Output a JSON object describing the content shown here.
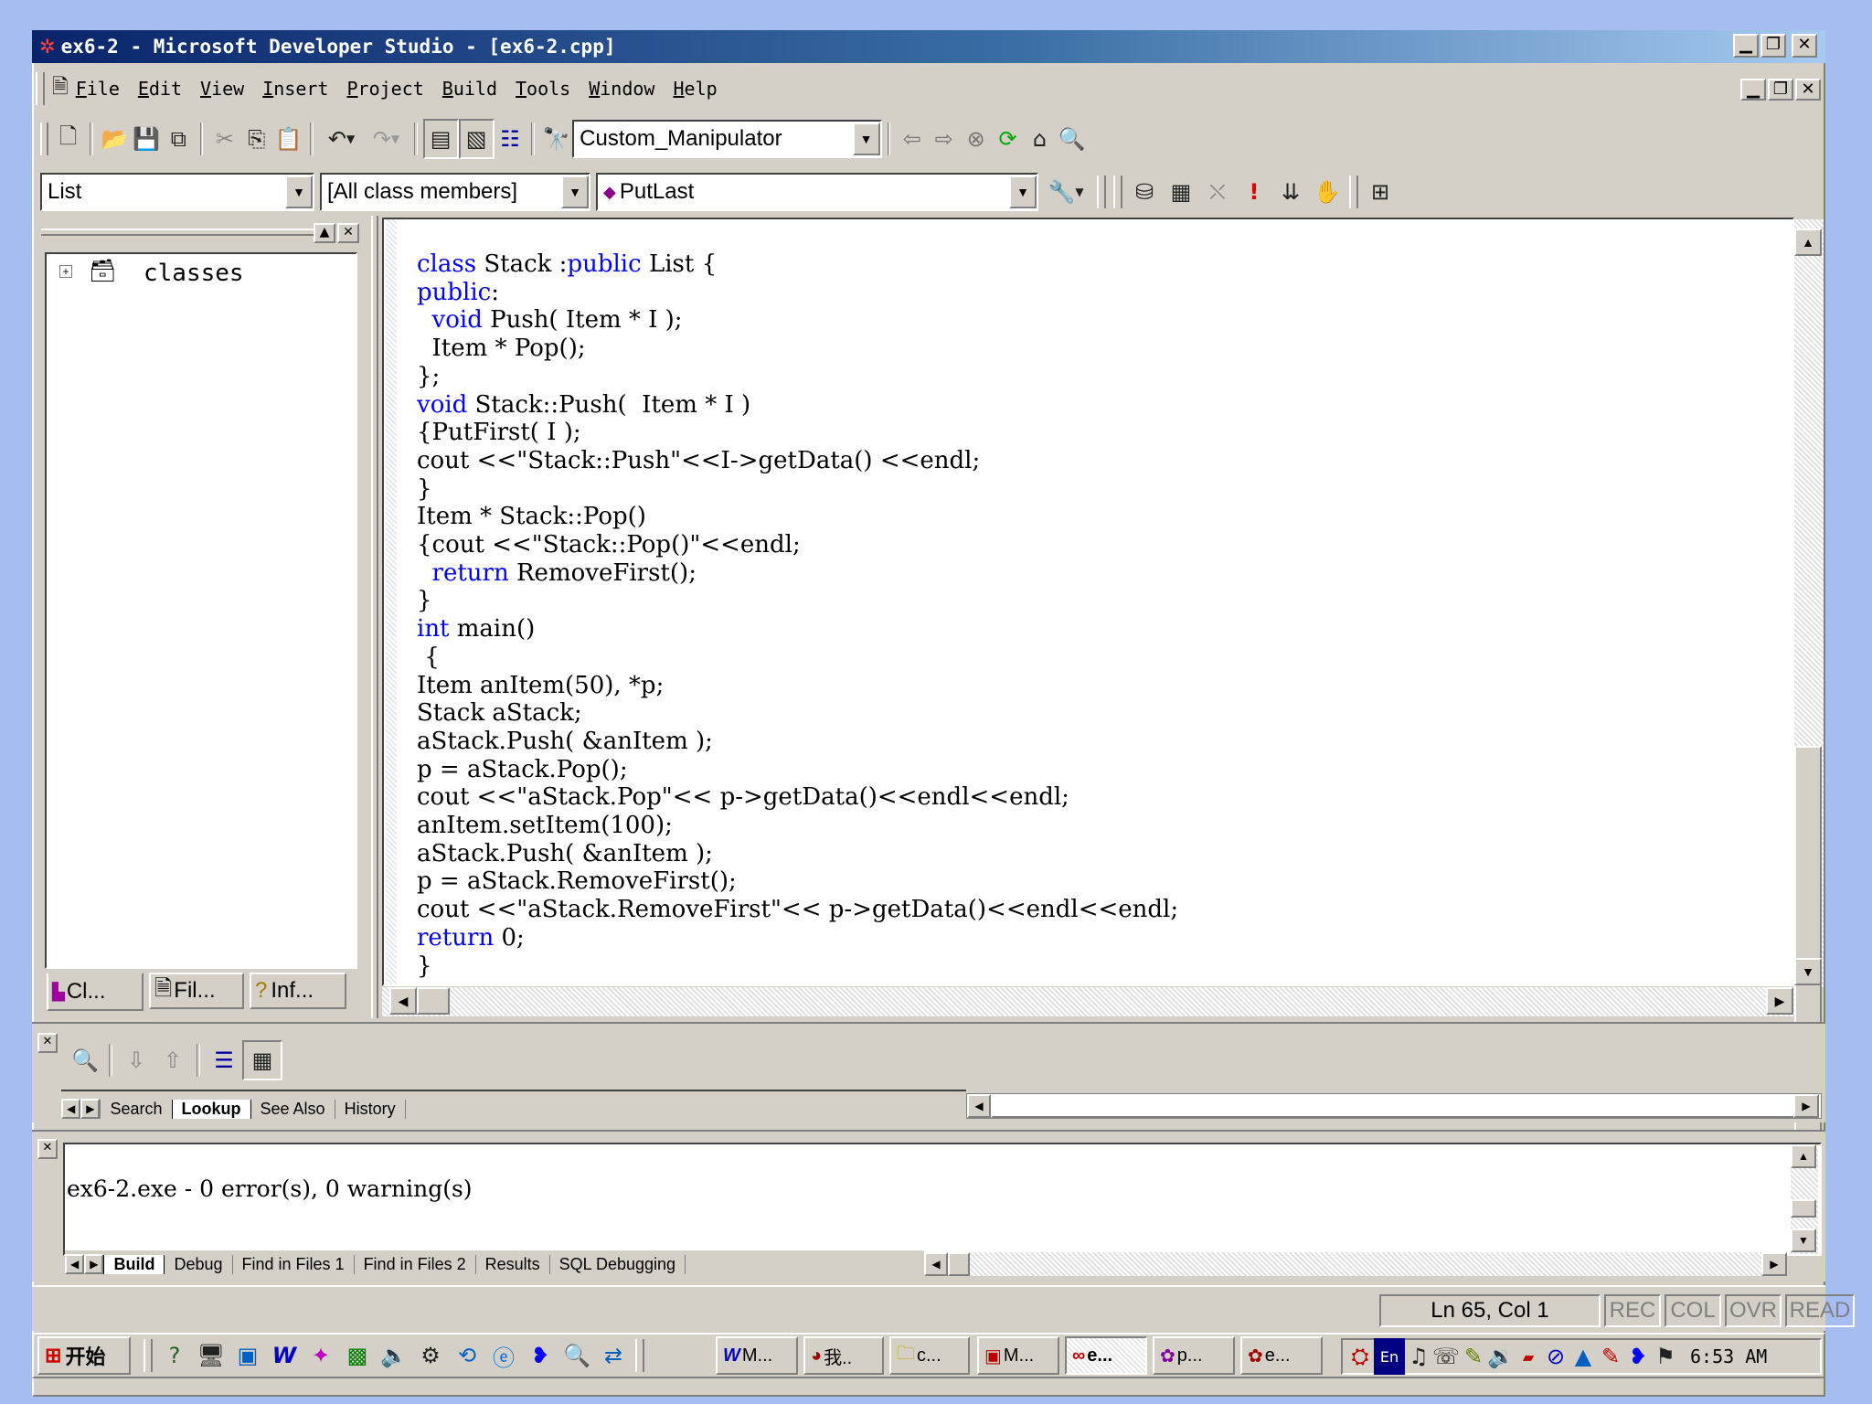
{
  "window": {
    "title": "ex6-2 - Microsoft Developer Studio - [ex6-2.cpp]"
  },
  "menu": [
    "File",
    "Edit",
    "View",
    "Insert",
    "Project",
    "Build",
    "Tools",
    "Window",
    "Help"
  ],
  "toolbar": {
    "find_combo_value": "Custom_Manipulator"
  },
  "wizardbar": {
    "class_combo": "List",
    "filter_combo": "[All class members]",
    "member_combo": "PutLast"
  },
  "workspace": {
    "tree_root": "classes",
    "tabs": [
      "Cl...",
      "Fil...",
      "Inf..."
    ]
  },
  "editor": {
    "lines": [
      "class Stack :public List {",
      "public:",
      "  void Push( Item * I );",
      "  Item * Pop();",
      "};",
      "void Stack::Push(  Item * I )",
      "{PutFirst( I );",
      "cout <<\"Stack::Push\"<<I->getData() <<endl;",
      "}",
      "Item * Stack::Pop()",
      "{cout <<\"Stack::Pop()\"<<endl;",
      "  return RemoveFirst();",
      "}",
      "int main()",
      " {",
      "Item anItem(50), *p;",
      "Stack aStack;",
      "aStack.Push( &anItem );",
      "p = aStack.Pop();",
      "cout <<\"aStack.Pop\"<< p->getData()<<endl<<endl;",
      "anItem.setItem(100);",
      "aStack.Push( &anItem );",
      "p = aStack.RemoveFirst();",
      "cout <<\"aStack.RemoveFirst\"<< p->getData()<<endl<<endl;",
      "return 0;",
      "}"
    ]
  },
  "infoviewer": {
    "tabs": [
      "Search",
      "Lookup",
      "See Also",
      "History"
    ],
    "active": "Lookup"
  },
  "output": {
    "text": "ex6-2.exe - 0 error(s), 0 warning(s)",
    "tabs": [
      "Build",
      "Debug",
      "Find in Files 1",
      "Find in Files 2",
      "Results",
      "SQL Debugging"
    ],
    "active": "Build"
  },
  "statusbar": {
    "position": "Ln 65, Col 1",
    "indicators": [
      "REC",
      "COL",
      "OVR",
      "READ"
    ]
  },
  "taskbar": {
    "start_label": "开始",
    "tasks": [
      "M...",
      "我..",
      "c...",
      "M...",
      "e...",
      "p...",
      "e..."
    ],
    "tray_lang": "En",
    "clock": "6:53 AM"
  },
  "colors": {
    "titlebar": "#0a246a",
    "keyword": "#0000ff",
    "desktop": "#a6bdf2",
    "face": "#d4d0c8"
  }
}
